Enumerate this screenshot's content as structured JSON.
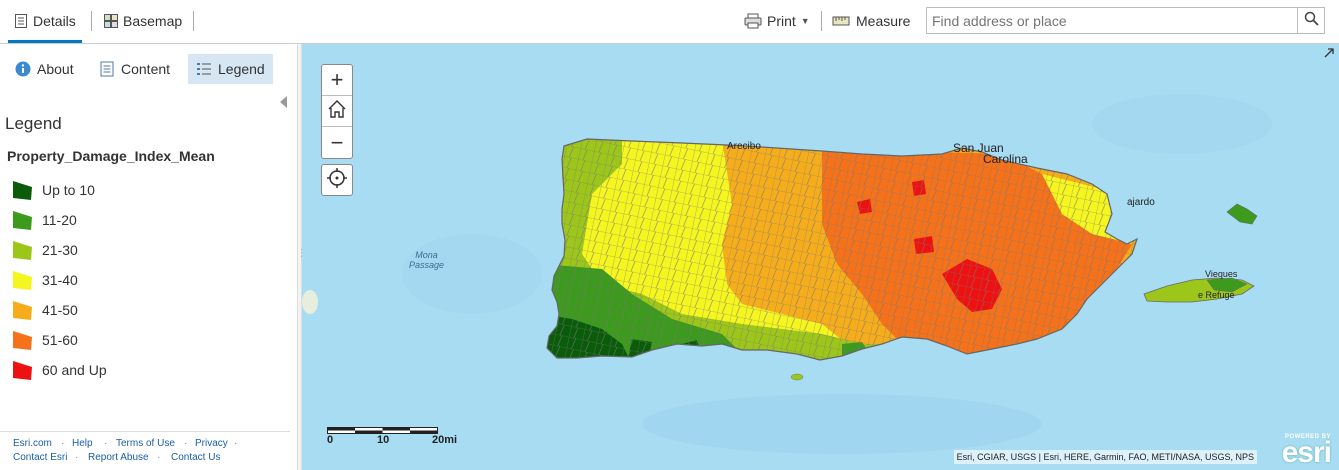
{
  "toolbar": {
    "details_label": "Details",
    "basemap_label": "Basemap",
    "print_label": "Print",
    "measure_label": "Measure",
    "search_placeholder": "Find address or place"
  },
  "panel": {
    "tabs": [
      {
        "label": "About",
        "icon": "info-icon"
      },
      {
        "label": "Content",
        "icon": "content-icon"
      },
      {
        "label": "Legend",
        "icon": "legend-icon",
        "active": true
      }
    ],
    "legend_heading": "Legend",
    "layer_title": "Property_Damage_Index_Mean",
    "legend_items": [
      {
        "label": "Up to 10",
        "color": "#0a5c0a"
      },
      {
        "label": "11-20",
        "color": "#3c9a1c"
      },
      {
        "label": "21-30",
        "color": "#9dc61a"
      },
      {
        "label": "31-40",
        "color": "#f5f51f"
      },
      {
        "label": "41-50",
        "color": "#f6ad1b"
      },
      {
        "label": "51-60",
        "color": "#f5721a"
      },
      {
        "label": "60 and Up",
        "color": "#ee1111"
      }
    ],
    "footer": {
      "esri_com": "Esri.com",
      "help": "Help",
      "terms": "Terms of Use",
      "privacy": "Privacy",
      "contact_esri": "Contact Esri",
      "report_abuse": "Report Abuse",
      "contact_us": "Contact Us"
    }
  },
  "map": {
    "zoom_in": "+",
    "zoom_out": "−",
    "place_labels": {
      "arecibo": "Arecibo",
      "san_juan": "San Juan",
      "carolina": "Carolina",
      "fajardo": "ajardo",
      "vieques": "Vieques",
      "refuge": "e Refuge",
      "mona_1": "Mona",
      "mona_2": "Passage"
    },
    "scale": {
      "l0": "0",
      "l1": "10",
      "l2": "20mi"
    },
    "attribution": "Esri, CGIAR, USGS | Esri, HERE, Garmin, FAO, METI/NASA, USGS, NPS",
    "esri_powered": "POWERED BY",
    "esri_word": "esri"
  }
}
